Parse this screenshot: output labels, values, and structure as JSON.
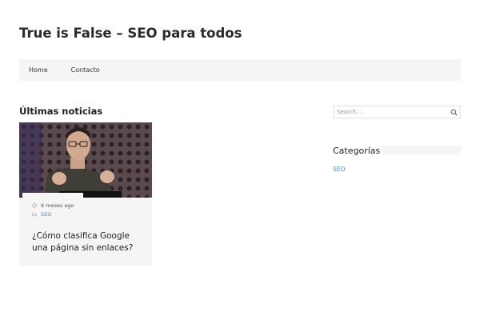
{
  "site": {
    "title": "True is False – SEO para todos"
  },
  "nav": {
    "items": [
      {
        "label": "Home"
      },
      {
        "label": "Contacto"
      }
    ]
  },
  "main": {
    "heading": "Últimas noticias",
    "posts": [
      {
        "date": "6 meses ago",
        "category": "SEO",
        "title": "¿Cómo clasifica Google una página sin enlaces?",
        "image_icon": "person-photo"
      }
    ]
  },
  "sidebar": {
    "search": {
      "placeholder": "Search...",
      "value": ""
    },
    "categories": {
      "title": "Categorías",
      "items": [
        {
          "label": "SEO"
        }
      ]
    }
  },
  "colors": {
    "accent": "#3b8fd1",
    "nav_bg": "#f5f5f5",
    "card_bg": "#f5f5f5"
  }
}
